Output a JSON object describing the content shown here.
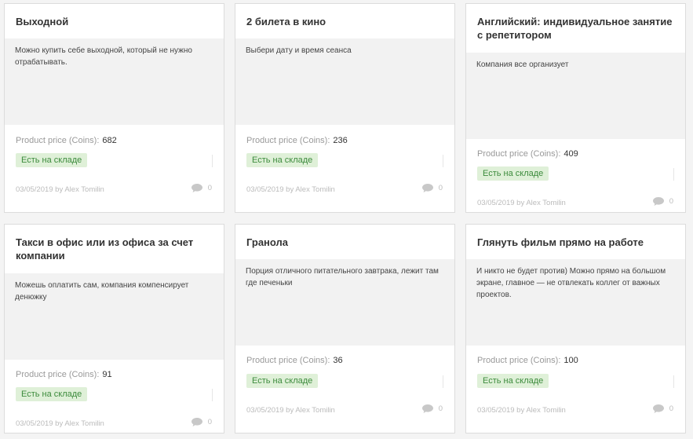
{
  "products": [
    {
      "title": "Выходной",
      "description": "Можно купить себе выходной, который не нужно отрабатывать.",
      "price_label": "Product price (Coins):",
      "price": "682",
      "stock": "Есть на складе",
      "meta": "03/05/2019 by Alex Tomilin",
      "comments": "0"
    },
    {
      "title": "2 билета в кино",
      "description": "Выбери дату и время сеанса",
      "price_label": "Product price (Coins):",
      "price": "236",
      "stock": "Есть на складе",
      "meta": "03/05/2019 by Alex Tomilin",
      "comments": "0"
    },
    {
      "title": "Английский: индивидуальное занятие с репетитором",
      "description": "Компания все организует",
      "price_label": "Product price (Coins):",
      "price": "409",
      "stock": "Есть на складе",
      "meta": "03/05/2019 by Alex Tomilin",
      "comments": "0"
    },
    {
      "title": "Такси в офис или из офиса за счет компании",
      "description": "Можешь оплатить сам, компания компенсирует денюжку",
      "price_label": "Product price (Coins):",
      "price": "91",
      "stock": "Есть на складе",
      "meta": "03/05/2019 by Alex Tomilin",
      "comments": "0"
    },
    {
      "title": "Гранола",
      "description": "Порция отличного питательного завтрака, лежит там где печеньки",
      "price_label": "Product price (Coins):",
      "price": "36",
      "stock": "Есть на складе",
      "meta": "03/05/2019 by Alex Tomilin",
      "comments": "0"
    },
    {
      "title": "Глянуть фильм прямо на работе",
      "description": "И никто не будет против) Можно прямо на большом экране, главное — не отвлекать коллег от важных проектов.",
      "price_label": "Product price (Coins):",
      "price": "100",
      "stock": "Есть на складе",
      "meta": "03/05/2019 by Alex Tomilin",
      "comments": "0"
    }
  ],
  "colors": {
    "stock_bg": "#dff0d8",
    "stock_text": "#3c8b3c",
    "desc_bg": "#f2f2f2"
  },
  "icons": {
    "comments": "comment-bubble-icon"
  }
}
